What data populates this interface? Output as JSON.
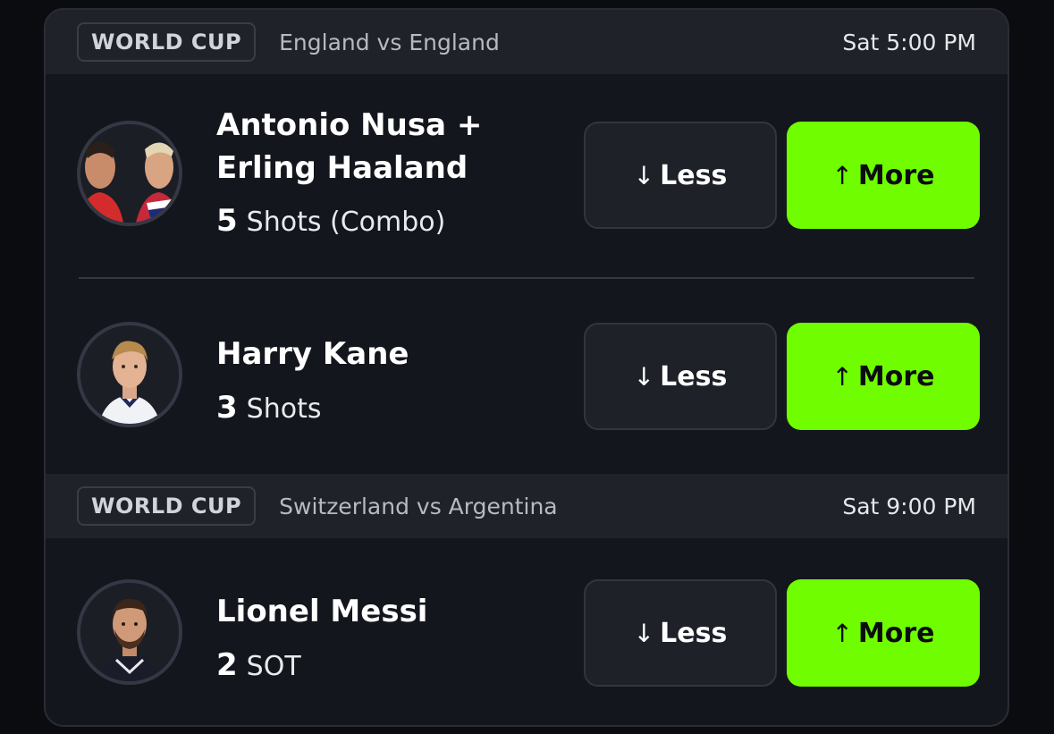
{
  "sections": [
    {
      "league": "WORLD CUP",
      "matchup": "England vs England",
      "time": "Sat 5:00 PM",
      "picks": [
        {
          "player_name": "Antonio Nusa + Erling Haaland",
          "line_value": "5",
          "stat": "Shots (Combo)",
          "less_label": "Less",
          "more_label": "More"
        },
        {
          "player_name": "Harry Kane",
          "line_value": "3",
          "stat": "Shots",
          "less_label": "Less",
          "more_label": "More"
        }
      ]
    },
    {
      "league": "WORLD CUP",
      "matchup": "Switzerland vs Argentina",
      "time": "Sat 9:00 PM",
      "picks": [
        {
          "player_name": "Lionel Messi",
          "line_value": "2",
          "stat": "SOT",
          "less_label": "Less",
          "more_label": "More"
        }
      ]
    }
  ],
  "icons": {
    "less": "arrow-down-icon",
    "more": "arrow-up-icon"
  },
  "colors": {
    "more_button": "#6ffd00",
    "less_button": "#1f2129",
    "card_background": "#14161d",
    "header_background": "#20222a"
  }
}
